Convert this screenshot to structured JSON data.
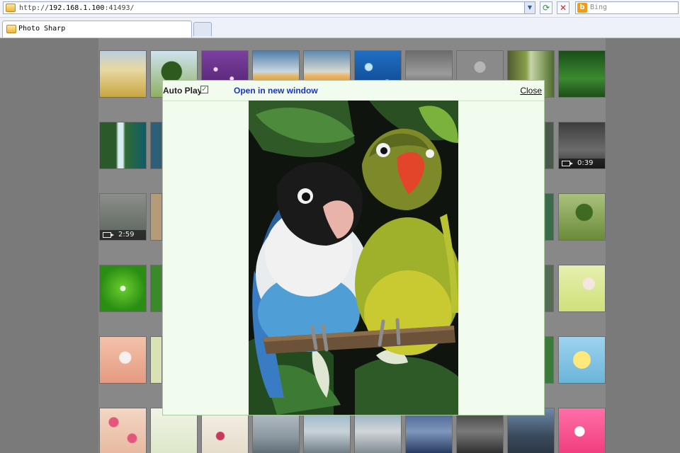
{
  "browser": {
    "url_prefix": "http://",
    "url_host": "192.168.1.100",
    "url_port": ":41493/",
    "search_engine": "Bing",
    "tab_title": "Photo Sharp"
  },
  "viewer": {
    "autoplay_label": "Auto Play",
    "autoplay_checked": true,
    "open_new_window_label": "Open in new window",
    "close_label": "Close"
  },
  "gallery": {
    "video_durations": [
      "0:39",
      "2:59"
    ]
  },
  "icons": [
    "page-icon",
    "dropdown-icon",
    "refresh-icon",
    "stop-icon",
    "bing-icon",
    "checkbox-icon",
    "video-camera-icon"
  ],
  "colors": {
    "modal_bg": "#f1fbee",
    "link_blue": "#1a34c8",
    "overlay": "#7a7a7a"
  }
}
